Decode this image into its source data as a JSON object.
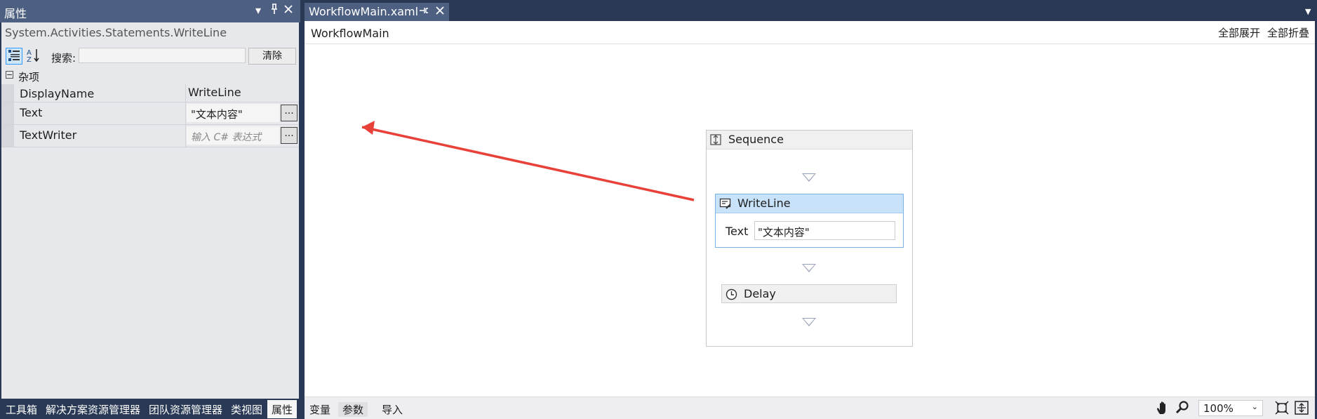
{
  "properties_panel": {
    "title": "属性",
    "dropdown_icon": "▾",
    "pin_icon": "⊥",
    "close_icon": "✕",
    "selected_type": "System.Activities.Statements.WriteLine",
    "search_label": "搜索:",
    "search_value": "",
    "clear_label": "清除",
    "category": "杂项",
    "rows": [
      {
        "name": "DisplayName",
        "value": "WriteLine"
      },
      {
        "name": "Text",
        "value": "\"文本内容\""
      },
      {
        "name": "TextWriter",
        "value": "输入 C# 表达式"
      }
    ],
    "ellipsis": "..."
  },
  "bottom_tabs": [
    "工具箱",
    "解决方案资源管理器",
    "团队资源管理器",
    "类视图",
    "属性"
  ],
  "document": {
    "tab_name": "WorkflowMain.xaml",
    "breadcrumb": "WorkflowMain",
    "expand_all": "全部展开",
    "collapse_all": "全部折叠"
  },
  "workflow": {
    "sequence_label": "Sequence",
    "writeline_label": "WriteLine",
    "text_label": "Text",
    "text_value": "\"文本内容\"",
    "delay_label": "Delay"
  },
  "status_bar": {
    "variables": "变量",
    "arguments": "参数",
    "imports": "导入",
    "zoom": "100%"
  },
  "colors": {
    "chrome": "#293955",
    "tab_active": "#4d6082",
    "annotation_arrow": "#e8413a"
  }
}
